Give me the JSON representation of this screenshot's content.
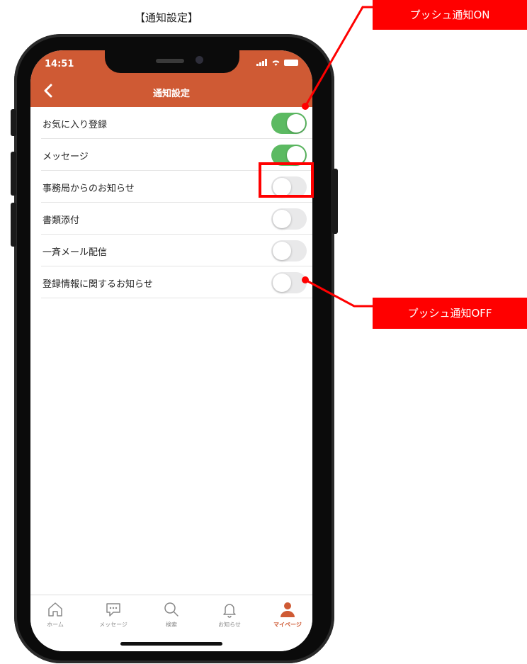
{
  "caption": "【通知設定】",
  "status_bar": {
    "time": "14:51"
  },
  "nav": {
    "title": "通知設定",
    "back_icon": "chevron-left-icon"
  },
  "settings": [
    {
      "label": "お気に入り登録",
      "enabled": true
    },
    {
      "label": "メッセージ",
      "enabled": true
    },
    {
      "label": "事務局からのお知らせ",
      "enabled": false
    },
    {
      "label": "書類添付",
      "enabled": false
    },
    {
      "label": "一斉メール配信",
      "enabled": false
    },
    {
      "label": "登録情報に関するお知らせ",
      "enabled": false
    }
  ],
  "tabbar": [
    {
      "label": "ホーム",
      "icon": "home-icon",
      "active": false
    },
    {
      "label": "メッセージ",
      "icon": "message-icon",
      "active": false
    },
    {
      "label": "検索",
      "icon": "search-icon",
      "active": false
    },
    {
      "label": "お知らせ",
      "icon": "bell-icon",
      "active": false
    },
    {
      "label": "マイページ",
      "icon": "user-icon",
      "active": true
    }
  ],
  "annotations": {
    "on_label": "プッシュ通知ON",
    "off_label": "プッシュ通知OFF"
  },
  "colors": {
    "brand": "#cf5a34",
    "toggle_on": "#5cba62",
    "toggle_off": "#e9e9ea",
    "annotation": "#ff0000"
  }
}
